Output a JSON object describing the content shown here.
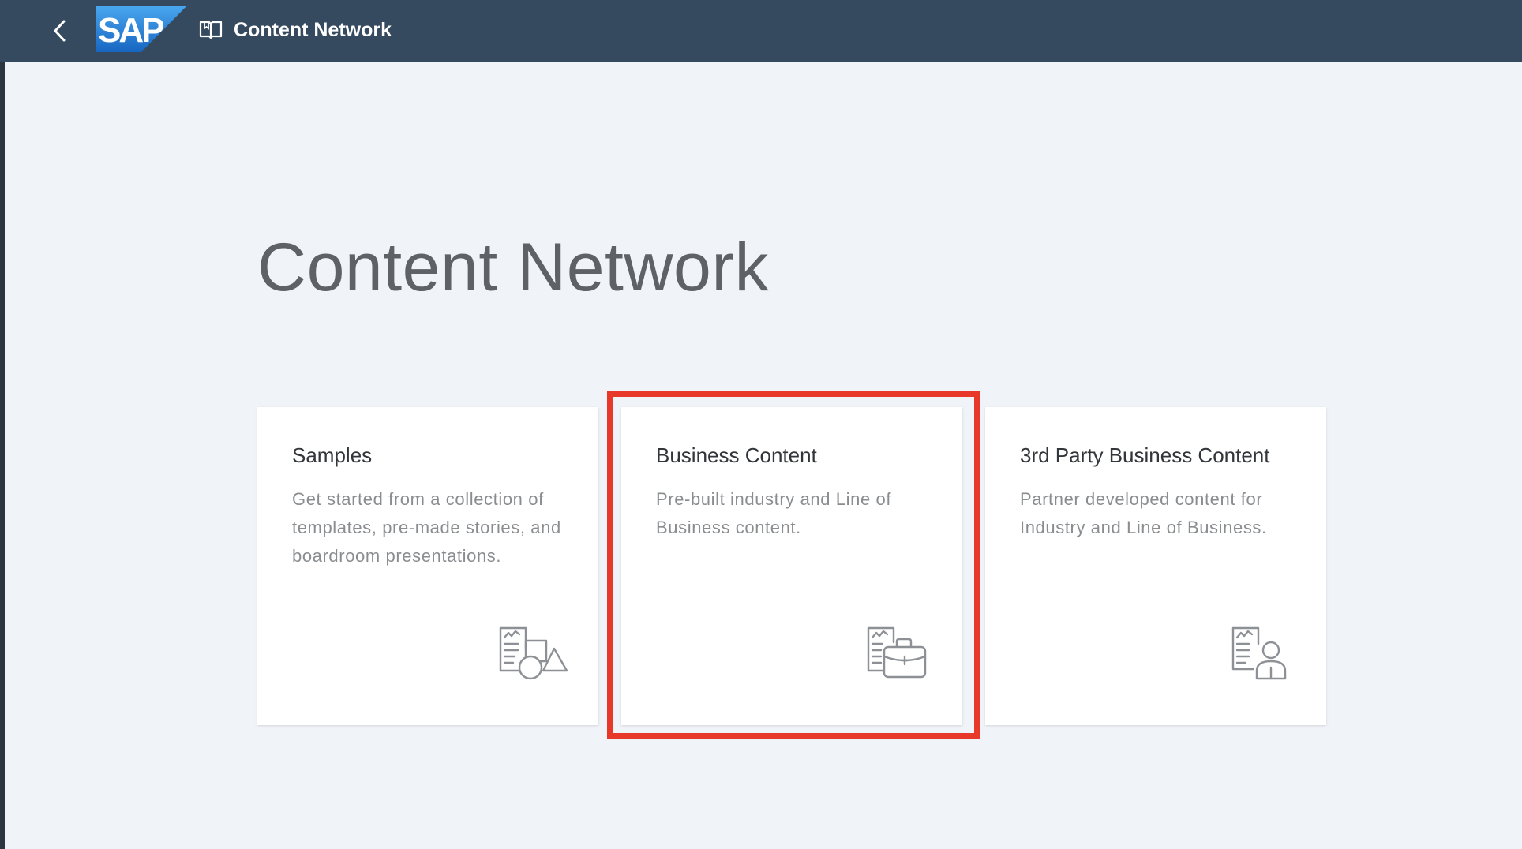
{
  "shellbar": {
    "logo_text": "SAP",
    "title": "Content Network"
  },
  "main": {
    "heading": "Content Network",
    "cards": [
      {
        "title": "Samples",
        "description": "Get started from a collection of templates, pre-made stories, and boardroom presentations.",
        "icon": "document-shapes-icon"
      },
      {
        "title": "Business Content",
        "description": "Pre-built industry and Line of Business content.",
        "icon": "document-briefcase-icon"
      },
      {
        "title": "3rd Party Business Content",
        "description": "Partner developed content for Industry and Line of Business.",
        "icon": "document-person-icon"
      }
    ]
  },
  "colors": {
    "shellbar": "#354a5f",
    "background": "#f0f3f7",
    "highlight": "#e8382a",
    "sap_blue": "#1f7fd6"
  }
}
